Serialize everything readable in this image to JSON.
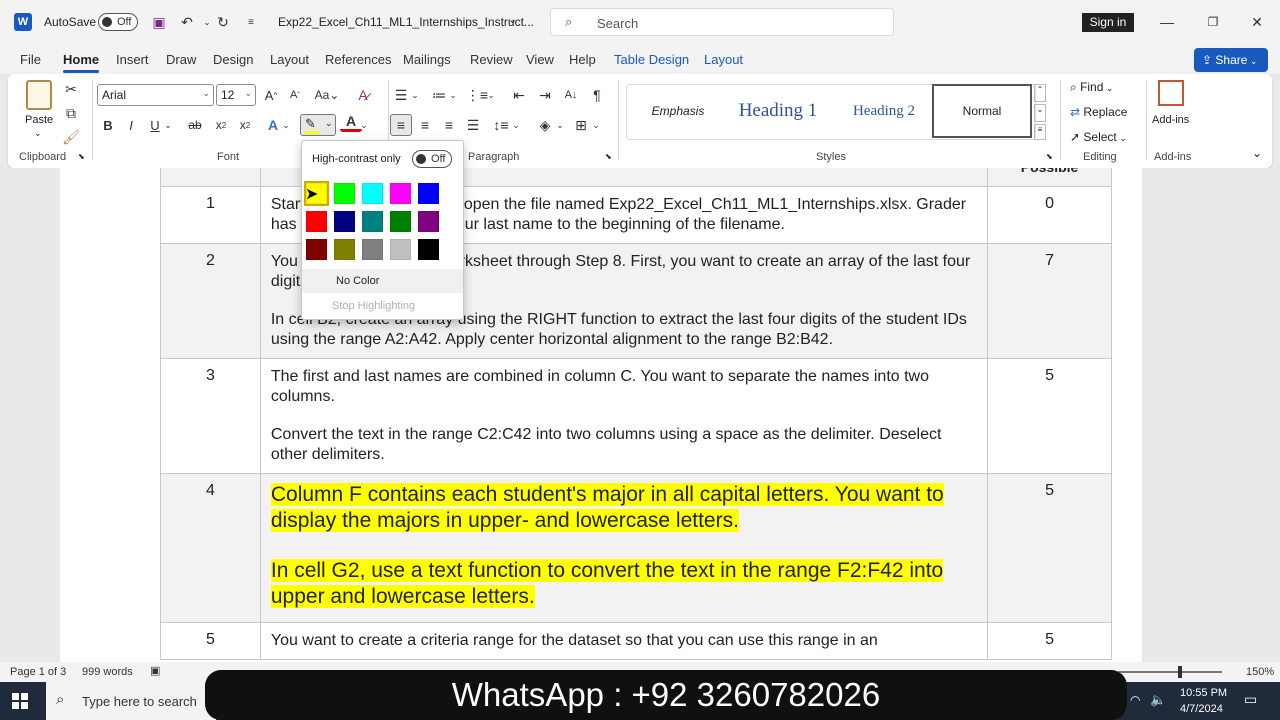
{
  "titlebar": {
    "autosave_label": "AutoSave",
    "autosave_state": "Off",
    "filename": "Exp22_Excel_Ch11_ML1_Internships_Instruct...",
    "search_placeholder": "Search",
    "signin": "Sign in"
  },
  "tabs": [
    "File",
    "Home",
    "Insert",
    "Draw",
    "Design",
    "Layout",
    "References",
    "Mailings",
    "Review",
    "View",
    "Help",
    "Table Design",
    "Layout"
  ],
  "share_label": "Share",
  "ribbon": {
    "paste": "Paste",
    "clipboard": "Clipboard",
    "font_name": "Arial",
    "font_size": "12",
    "font_group": "Font",
    "paragraph_group": "Paragraph",
    "styles": [
      "Emphasis",
      "Heading 1",
      "Heading 2",
      "Normal"
    ],
    "styles_group": "Styles",
    "find": "Find",
    "replace": "Replace",
    "select": "Select",
    "editing_group": "Editing",
    "addins": "Add-ins",
    "addins_group": "Add-ins"
  },
  "highlight_menu": {
    "high_contrast": "High-contrast only",
    "toggle": "Off",
    "colors": [
      "#ffff00",
      "#00ff00",
      "#00ffff",
      "#ff00ff",
      "#0000ff",
      "#ff0000",
      "#000080",
      "#008080",
      "#008000",
      "#800080",
      "#800000",
      "#808000",
      "#808080",
      "#c0c0c0",
      "#000000"
    ],
    "no_color": "No Color",
    "stop": "Stop Highlighting"
  },
  "table": {
    "header_partial": "Possible",
    "rows": [
      {
        "num": "1",
        "paras": [
          "Start Excel. Download and open the file named Exp22_Excel_Ch11_ML1_Internships.xlsx. Grader has automatically added your last name to the beginning of the filename."
        ],
        "pts": "0"
      },
      {
        "num": "2",
        "paras": [
          "You will use the Interns worksheet through Step 8. First, you want to create an array of the last four digits of the student IDs.",
          "In cell B2, create an array using the RIGHT function to extract the last four digits of the student IDs using the range A2:A42. Apply center horizontal alignment to the range B2:B42."
        ],
        "pts": "7"
      },
      {
        "num": "3",
        "paras": [
          "The first and last names are combined in column C. You want to separate the names into two columns.",
          "Convert the text in the range C2:C42 into two columns using a space as the delimiter. Deselect other delimiters."
        ],
        "pts": "5"
      },
      {
        "num": "4",
        "paras": [
          "Column F contains each student's major in all capital letters. You want to display the majors in upper- and lowercase letters.",
          "In cell G2, use a text function to convert the text in the range F2:F42 into upper and lowercase letters."
        ],
        "pts": "5"
      },
      {
        "num": "5",
        "paras": [
          "You want to create a criteria range for the dataset so that you can use this range in an"
        ],
        "pts": "5"
      }
    ]
  },
  "status": {
    "page": "Page 1 of 3",
    "words": "999 words",
    "zoom": "150%"
  },
  "taskbar": {
    "search": "Type here to search",
    "time": "10:55 PM",
    "date": "4/7/2024"
  },
  "overlay": "WhatsApp : +92 3260782026"
}
